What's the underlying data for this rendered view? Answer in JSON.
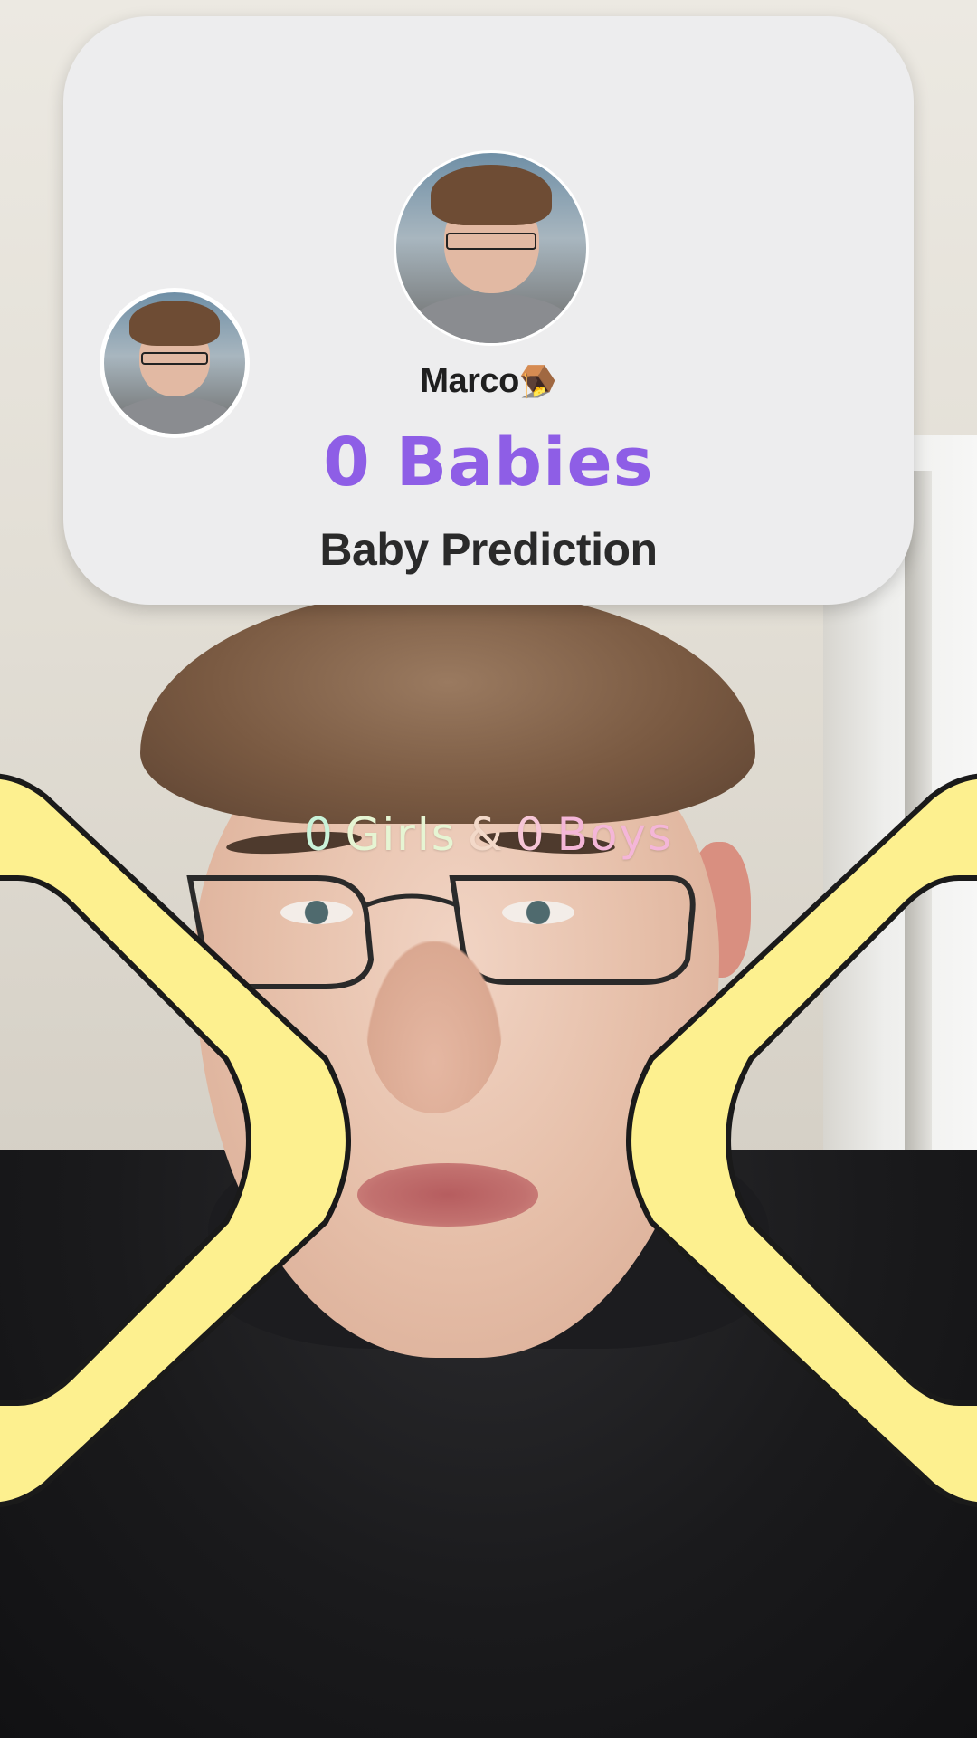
{
  "card": {
    "user_name": "Marco",
    "name_emoji": "🪤",
    "babies_count": "0",
    "babies_label": "Babies",
    "title": "Baby Prediction"
  },
  "overlay": {
    "girls_count": "0",
    "girls_label": "Girls",
    "amp": "&",
    "boys_count": "0",
    "boys_label": "Boys"
  },
  "colors": {
    "card_bg": "#ededee",
    "babies_text": "#8e5ee6",
    "bracket_fill": "#fdf08f",
    "bracket_stroke": "#1a1a1a",
    "girls_text": "#c9f3d9",
    "boys_text": "#f4b6d8"
  },
  "icons": {
    "main_avatar": "user-photo-avatar",
    "small_avatar": "user-photo-avatar-small"
  }
}
